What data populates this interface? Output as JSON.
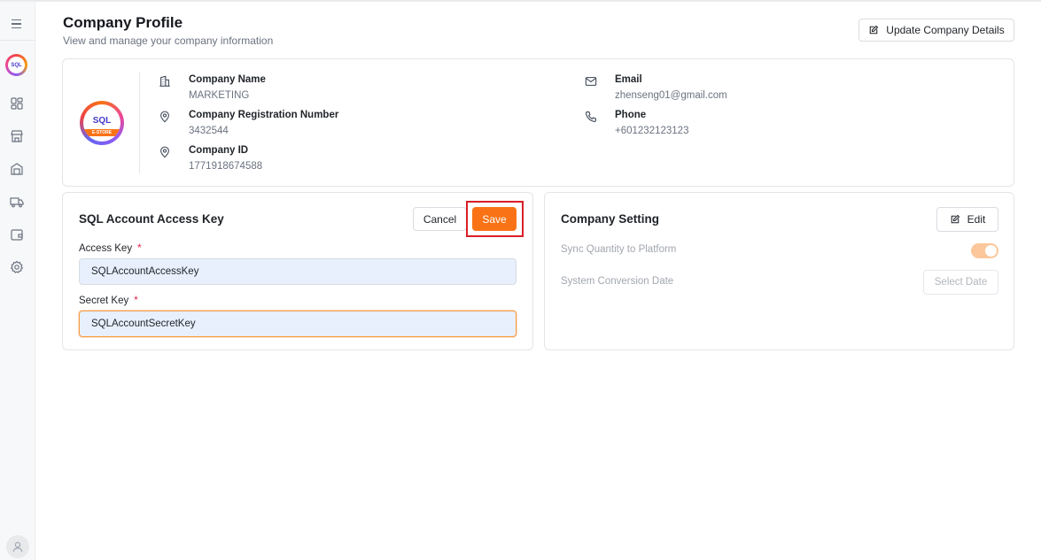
{
  "header": {
    "title": "Company Profile",
    "subtitle": "View and manage your company information",
    "update_button": "Update Company Details"
  },
  "sidebar": {
    "logo_text": "SQL",
    "items": [
      {
        "icon": "menu-icon"
      },
      {
        "icon": "dashboard-icon"
      },
      {
        "icon": "store-icon"
      },
      {
        "icon": "warehouse-icon"
      },
      {
        "icon": "truck-icon"
      },
      {
        "icon": "wallet-icon"
      },
      {
        "icon": "settings-icon"
      },
      {
        "icon": "user-icon"
      }
    ]
  },
  "profile": {
    "logo_text": "SQL",
    "logo_band": "E-STORE",
    "company_name_label": "Company Name",
    "company_name": "MARKETING",
    "reg_number_label": "Company Registration Number",
    "reg_number": "3432544",
    "company_id_label": "Company ID",
    "company_id": "1771918674588",
    "email_label": "Email",
    "email": "zhenseng01@gmail.com",
    "phone_label": "Phone",
    "phone": "+601232123123"
  },
  "access": {
    "title": "SQL Account Access Key",
    "cancel_label": "Cancel",
    "save_label": "Save",
    "access_key_label": "Access Key",
    "access_key_value": "SQLAccountAccessKey",
    "secret_key_label": "Secret Key",
    "secret_key_value": "SQLAccountSecretKey",
    "required_mark": "*"
  },
  "settings": {
    "title": "Company Setting",
    "edit_label": "Edit",
    "sync_label": "Sync Quantity to Platform",
    "sync_enabled": true,
    "conversion_label": "System Conversion Date",
    "select_date_label": "Select Date"
  },
  "colors": {
    "accent": "#f97316",
    "highlight": "#d91f26",
    "input_bg": "#e8f0fe"
  }
}
